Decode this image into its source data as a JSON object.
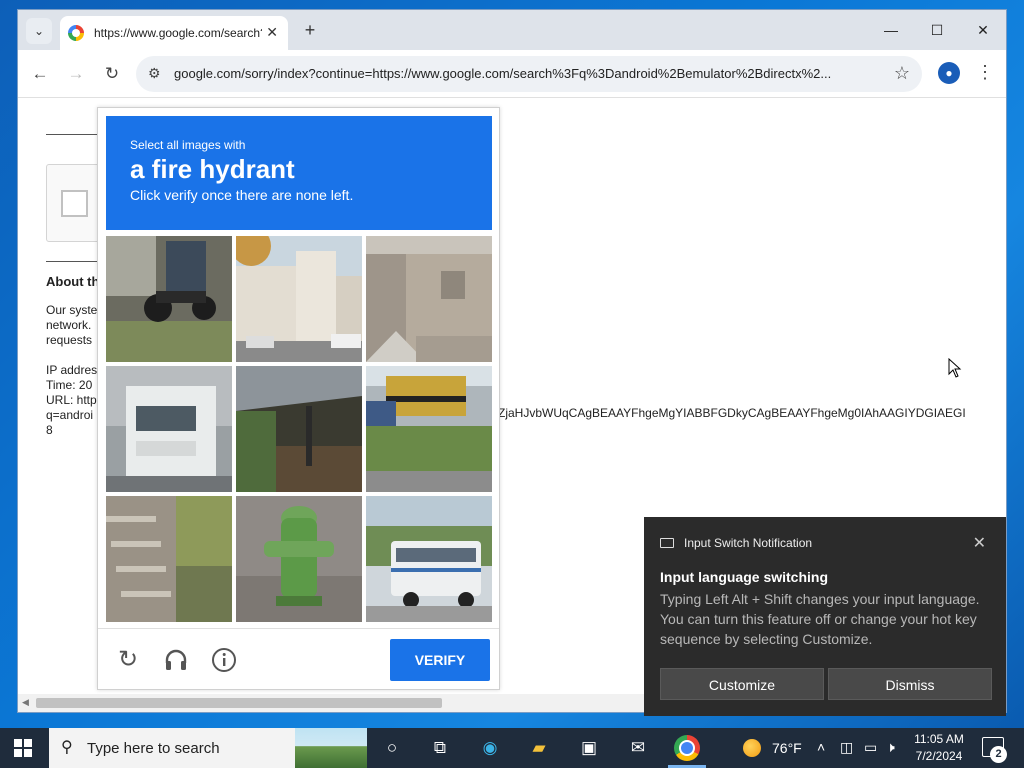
{
  "browser": {
    "tab_title": "https://www.google.com/search?",
    "address": "google.com/sorry/index?continue=https://www.google.com/search%3Fq%3Dandroid%2Bemulator%2Bdirectx%2..."
  },
  "page": {
    "about_heading": "About th",
    "para_lines": [
      "Our syste",
      "network.",
      "requests"
    ],
    "info_lines": [
      "IP addres",
      "Time: 20",
      "URL: http",
      "q=androi",
      "8"
    ],
    "long_url_fragment": "ZjaHJvbWUqCAgBEAAYFhgeMgYIABBFGDkyCAgBEAAYFhgeMg0IAhAAGIYDGIAEGI"
  },
  "captcha": {
    "instruction_small": "Select all images with",
    "target": "a fire hydrant",
    "instruction_sub": "Click verify once there are none left.",
    "verify_label": "VERIFY",
    "tiles": [
      "motorcycle",
      "street",
      "building-corner",
      "truck",
      "shed",
      "bus",
      "stairs",
      "fire-hydrant",
      "van"
    ]
  },
  "notification": {
    "header": "Input Switch Notification",
    "title": "Input language switching",
    "body": "Typing Left Alt + Shift changes your input language. You can turn this feature off or change your hot key sequence by selecting Customize.",
    "customize_label": "Customize",
    "dismiss_label": "Dismiss"
  },
  "taskbar": {
    "search_placeholder": "Type here to search",
    "temperature": "76°F",
    "time": "11:05 AM",
    "date": "7/2/2024",
    "notification_count": "2"
  },
  "colors": {
    "accent": "#1a73e8",
    "taskbar": "#1f2c3c",
    "toast": "#2b2b2b"
  }
}
